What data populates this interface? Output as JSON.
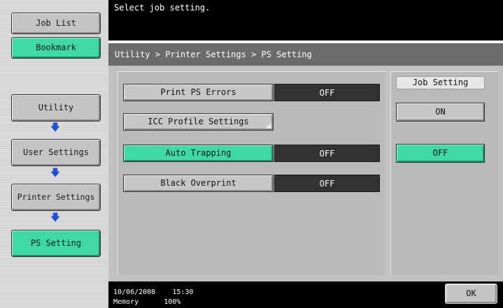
{
  "sidebar": {
    "job_list": "Job List",
    "bookmark": "Bookmark",
    "path": [
      "Utility",
      "User Settings",
      "Printer Settings",
      "PS Setting"
    ],
    "arrow_icon": "arrow-down-icon"
  },
  "message": "Select job setting.",
  "breadcrumb": "Utility > Printer Settings > PS Setting",
  "settings": [
    {
      "label": "Print PS Errors",
      "value": "OFF"
    },
    {
      "label": "ICC Profile Settings"
    },
    {
      "label": "Auto Trapping",
      "value": "OFF"
    },
    {
      "label": "Black Overprint",
      "value": "OFF"
    }
  ],
  "job_setting": {
    "label": "Job Setting",
    "on": "ON",
    "off": "OFF"
  },
  "footer": {
    "date": "10/06/2008",
    "time": "15:30",
    "memory_label": "Memory",
    "memory_value": "100%",
    "ok": "OK"
  },
  "colors": {
    "accent_green": "#3fd9a6",
    "arrow_blue": "#1f4fd6",
    "dark": "#000000"
  }
}
